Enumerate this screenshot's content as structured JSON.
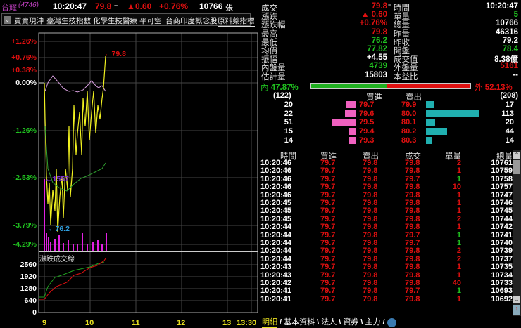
{
  "header": {
    "stock": "台耀",
    "code": "(4746)",
    "time": "10:20:47",
    "price": "79.8",
    "price_mark": "=",
    "change_arrow": "▲",
    "change": "0.60",
    "change_pct": "+0.76%",
    "volume": "10766",
    "volume_unit": "張"
  },
  "tabs": {
    "dropdown_icon": "chevron-down-icon",
    "items": [
      "買賣現沖",
      "臺灣生技指數",
      "化學生技醫療",
      "平可空",
      "台商印度概念股",
      "原料藥指標"
    ]
  },
  "chart": {
    "y_labels": [
      "+1.26%",
      "+0.76%",
      "+0.38%",
      "0.00%",
      "-1.26%",
      "-2.53%",
      "-3.79%",
      "-4.29%"
    ],
    "high_marker": "←79.8",
    "low_marker": "←76.2",
    "vol_marker": "←1557",
    "sub_title": "漲跌成交線",
    "sub_y_labels": [
      "2560",
      "1920",
      "1280",
      "640",
      "0"
    ],
    "x_labels": [
      "9",
      "10",
      "11",
      "12",
      "13",
      "13:30"
    ]
  },
  "stats": {
    "left": [
      {
        "label": "成交",
        "value": "79.8",
        "suffix": "=",
        "color": "#e01010"
      },
      {
        "label": "漲跌",
        "value": "▲ 0.60",
        "color": "#e01010"
      },
      {
        "label": "漲跌幅",
        "value": "+0.76%",
        "color": "#e01010"
      },
      {
        "label": "最高",
        "value": "79.8",
        "color": "#e01010"
      },
      {
        "label": "最低",
        "value": "76.2",
        "color": "#20c020"
      },
      {
        "label": "均價",
        "value": "77.82",
        "color": "#20c020"
      },
      {
        "label": "振幅",
        "value": "+4.55",
        "color": "#ffffff"
      },
      {
        "label": "內盤量",
        "value": "4739",
        "color": "#20c020"
      },
      {
        "label": "估計量",
        "value": "15803",
        "color": "#ffffff"
      }
    ],
    "right": [
      {
        "label": "時間",
        "value": "10:20:47",
        "color": "#ffffff"
      },
      {
        "label": "單量",
        "value": "5",
        "color": "#20c020"
      },
      {
        "label": "總量",
        "value": "10766",
        "color": "#ffffff"
      },
      {
        "label": "昨量",
        "value": "46316",
        "color": "#ffffff"
      },
      {
        "label": "昨收",
        "value": "79.2",
        "color": "#ffffff"
      },
      {
        "label": "開盤",
        "value": "78.4",
        "color": "#20c020"
      },
      {
        "label": "成交值",
        "value": "8.38億",
        "color": "#ffffff"
      },
      {
        "label": "外盤量",
        "value": "5161",
        "color": "#e01010"
      },
      {
        "label": "本益比",
        "value": "--",
        "color": "#ffffff"
      }
    ]
  },
  "ratio": {
    "inner_label": "內",
    "inner_pct": "47.87%",
    "outer_label": "外",
    "outer_pct": "52.13%",
    "inner_fraction": 0.4787
  },
  "orderbook": {
    "bid_total": "(122)",
    "ask_total": "(208)",
    "bid_header": "買進",
    "ask_header": "賣出",
    "rows": [
      {
        "bid_qty": "20",
        "bid": "79.7",
        "ask": "79.9",
        "ask_qty": "17"
      },
      {
        "bid_qty": "22",
        "bid": "79.6",
        "ask": "80.0",
        "ask_qty": "113"
      },
      {
        "bid_qty": "51",
        "bid": "79.5",
        "ask": "80.1",
        "ask_qty": "20"
      },
      {
        "bid_qty": "15",
        "bid": "79.4",
        "ask": "80.2",
        "ask_qty": "44"
      },
      {
        "bid_qty": "14",
        "bid": "79.3",
        "ask": "80.3",
        "ask_qty": "14"
      }
    ]
  },
  "trades": {
    "headers": [
      "時間",
      "買進",
      "賣出",
      "成交",
      "單量",
      "總量"
    ],
    "rows": [
      [
        "10:20:46",
        "79.7",
        "79.8",
        "79.8",
        "2",
        "10761"
      ],
      [
        "10:20:46",
        "79.7",
        "79.8",
        "79.8",
        "1",
        "10759"
      ],
      [
        "10:20:46",
        "79.7",
        "79.8",
        "79.7",
        "1",
        "10758"
      ],
      [
        "10:20:46",
        "79.7",
        "79.8",
        "79.8",
        "10",
        "10757"
      ],
      [
        "10:20:46",
        "79.7",
        "79.8",
        "79.8",
        "1",
        "10747"
      ],
      [
        "10:20:45",
        "79.7",
        "79.8",
        "79.8",
        "1",
        "10746"
      ],
      [
        "10:20:45",
        "79.7",
        "79.8",
        "79.8",
        "1",
        "10745"
      ],
      [
        "10:20:45",
        "79.7",
        "79.8",
        "79.8",
        "2",
        "10744"
      ],
      [
        "10:20:44",
        "79.7",
        "79.8",
        "79.8",
        "1",
        "10742"
      ],
      [
        "10:20:44",
        "79.7",
        "79.8",
        "79.7",
        "1",
        "10741"
      ],
      [
        "10:20:44",
        "79.7",
        "79.8",
        "79.7",
        "1",
        "10740"
      ],
      [
        "10:20:44",
        "79.7",
        "79.8",
        "79.8",
        "2",
        "10739"
      ],
      [
        "10:20:44",
        "79.7",
        "79.8",
        "79.8",
        "2",
        "10737"
      ],
      [
        "10:20:43",
        "79.7",
        "79.8",
        "79.8",
        "1",
        "10735"
      ],
      [
        "10:20:43",
        "79.7",
        "79.8",
        "79.8",
        "1",
        "10734"
      ],
      [
        "10:20:42",
        "79.7",
        "79.8",
        "79.8",
        "40",
        "10733"
      ],
      [
        "10:20:41",
        "79.7",
        "79.8",
        "79.7",
        "1",
        "10693"
      ],
      [
        "10:20:41",
        "79.7",
        "79.8",
        "79.8",
        "1",
        "10692"
      ]
    ]
  },
  "bottom_tabs": [
    "明細",
    "基本資料",
    "法人",
    "資券",
    "主力"
  ]
}
